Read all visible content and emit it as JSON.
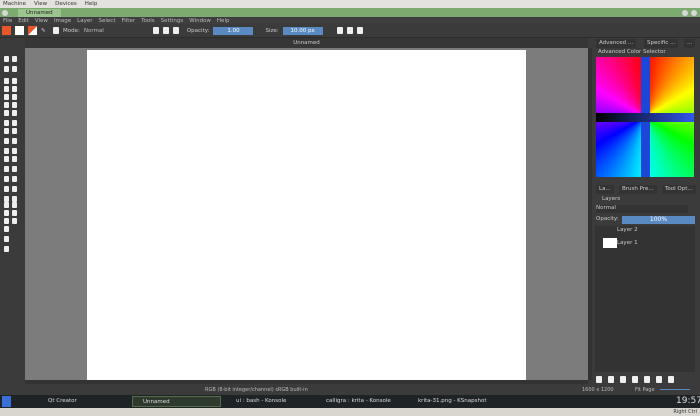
{
  "vm_menu": [
    "Machine",
    "View",
    "Devices",
    "Help"
  ],
  "window_title": "Unnamed",
  "app_menu": [
    "File",
    "Edit",
    "View",
    "Image",
    "Layer",
    "Select",
    "Filter",
    "Tools",
    "Settings",
    "Window",
    "Help"
  ],
  "toolbar": {
    "mode_label": "Mode:",
    "mode_value": "Normal",
    "opacity_label": "Opacity:",
    "opacity_value": "1.00",
    "size_label": "Size:",
    "size_value": "10.00 px"
  },
  "document_tab": "Unnamed",
  "dock": {
    "top_tabs": [
      "Advanced ...",
      "Specific ...",
      "..."
    ],
    "color_selector_title": "Advanced Color Selector",
    "mid_tabs": [
      "La...",
      "Brush Pre...",
      "Tool Opt..."
    ],
    "layers_title": "Layers",
    "blend_mode": "Normal",
    "opacity_label": "Opacity:",
    "opacity_value": "100%",
    "opacity_fraction": 1.0,
    "layers": [
      "Layer 2",
      "Layer 1"
    ]
  },
  "status": {
    "color_space": "RGB (8-bit integer/channel)  sRGB built-in",
    "dimensions": "1600 x 1200",
    "zoom": "Fit Page"
  },
  "taskbar": {
    "tasks": [
      "Qt Creator",
      "Unnamed",
      "ui : bash - Konsole",
      "calligra : krita - Konsole",
      "krita-31.png - KSnapshot"
    ],
    "clock": "19:57"
  },
  "vm_status": "Right Ctrl"
}
